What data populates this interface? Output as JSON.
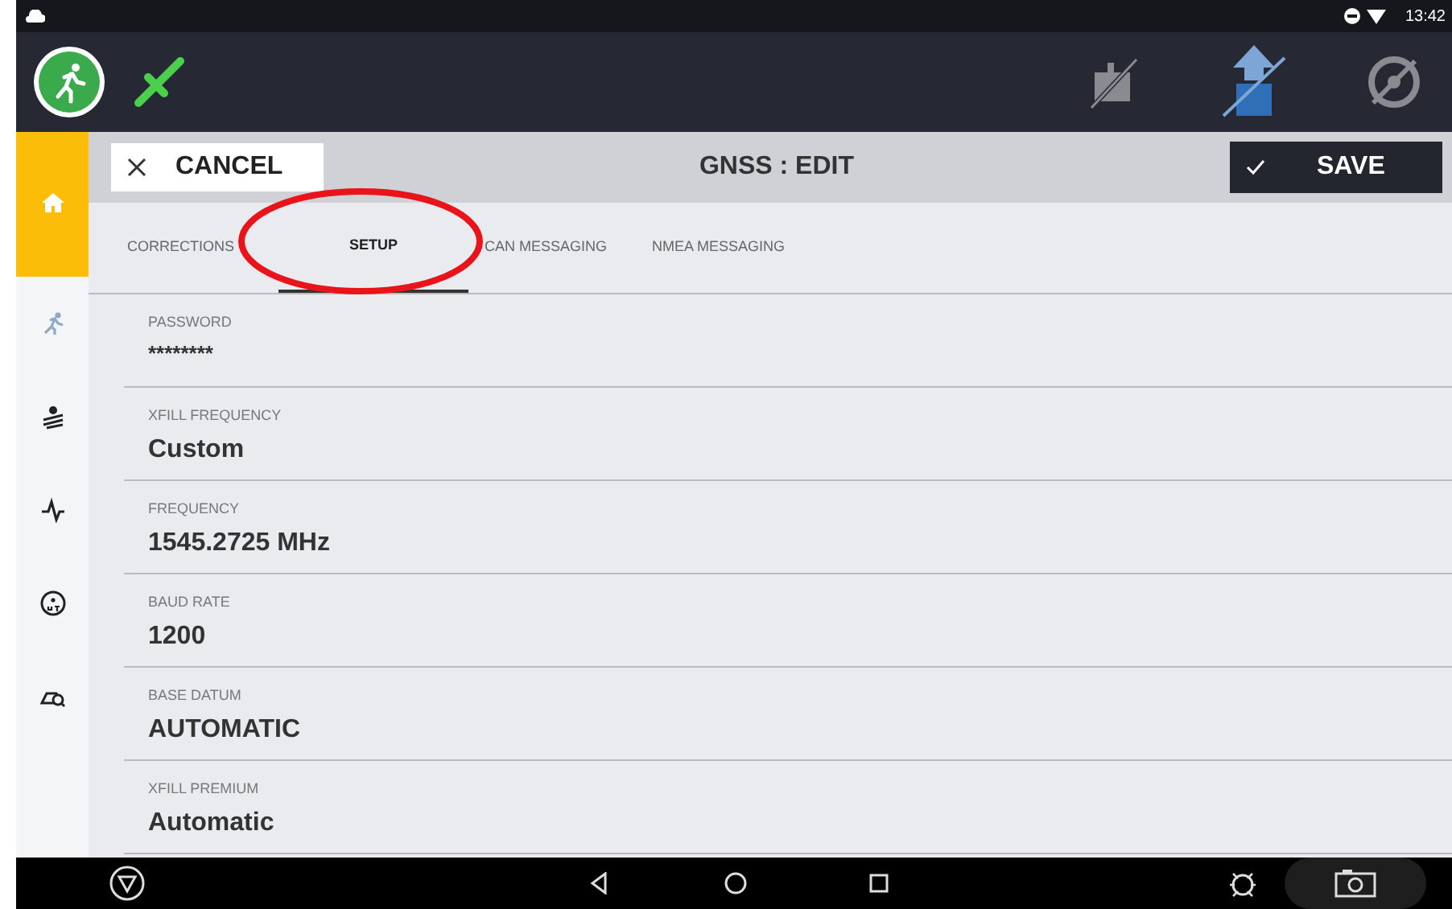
{
  "status_bar": {
    "time": "13:42"
  },
  "header": {
    "cancel": "CANCEL",
    "title": "GNSS : EDIT",
    "save": "SAVE"
  },
  "sidebar": {
    "items": [
      {
        "selected": true
      },
      {
        "selected": false
      },
      {
        "selected": false
      },
      {
        "selected": false
      },
      {
        "selected": false
      },
      {
        "selected": false
      }
    ]
  },
  "tabs": [
    {
      "label": "CORRECTIONS",
      "selected": false
    },
    {
      "label": "SETUP",
      "selected": true
    },
    {
      "label": "CAN MESSAGING",
      "selected": false
    },
    {
      "label": "NMEA MESSAGING",
      "selected": false
    }
  ],
  "fields": [
    {
      "label": "PASSWORD",
      "value": "********"
    },
    {
      "label": "XFILL FREQUENCY",
      "value": "Custom"
    },
    {
      "label": "FREQUENCY",
      "value": "1545.2725 MHz"
    },
    {
      "label": "BAUD RATE",
      "value": "1200"
    },
    {
      "label": "BASE DATUM",
      "value": "AUTOMATIC"
    },
    {
      "label": "XFILL PREMIUM",
      "value": "Automatic"
    }
  ]
}
